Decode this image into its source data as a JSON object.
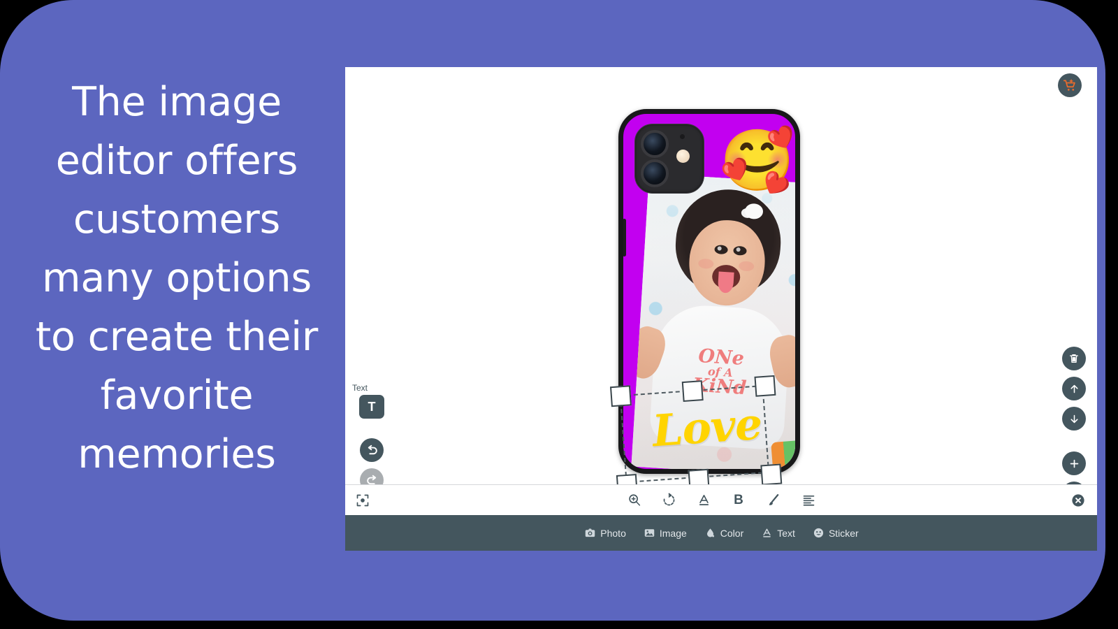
{
  "caption": {
    "text": "The image\neditor offers\ncustomers\nmany options\nto create their\nfavorite\nmemories"
  },
  "colors": {
    "backdrop": "#5c66bf",
    "toolbar": "#44565e",
    "case_background": "#c200f0",
    "love_text": "#ffd400",
    "cart_accent": "#ef6c2b",
    "shirt_text": "#ef7d7d"
  },
  "editor": {
    "cart_button": {
      "label": "",
      "icon": "add-to-cart-icon"
    },
    "left_tools": {
      "active_tool_label": "Text",
      "active_tool_glyph": "T",
      "undo_label": "Undo",
      "redo_label": "Redo",
      "redo_disabled": true
    },
    "right_tools": [
      {
        "name": "delete",
        "icon": "trash-icon",
        "label": "Delete"
      },
      {
        "name": "move-up",
        "icon": "arrow-up-icon",
        "label": "Bring forward"
      },
      {
        "name": "move-down",
        "icon": "arrow-down-icon",
        "label": "Send backward"
      },
      {
        "name": "zoom-in",
        "icon": "plus-icon",
        "label": "Zoom in"
      },
      {
        "name": "zoom-out",
        "icon": "minus-icon",
        "label": "Zoom out"
      }
    ],
    "text_toolbar": {
      "left_icon": "focus-center-icon",
      "items": [
        {
          "name": "size",
          "icon": "magnifier-plus-icon",
          "label": "Size"
        },
        {
          "name": "rotate",
          "icon": "rotate-icon",
          "label": "Rotate"
        },
        {
          "name": "underline",
          "icon": "underline-a-icon",
          "label": "A"
        },
        {
          "name": "bold",
          "icon": "bold-icon",
          "label": "B"
        },
        {
          "name": "brush",
          "icon": "brush-icon",
          "label": "Brush"
        },
        {
          "name": "align",
          "icon": "align-icon",
          "label": "Align"
        }
      ],
      "close_icon": "close-circle-icon"
    },
    "bottom_nav": [
      {
        "label": "Photo",
        "icon": "camera-icon"
      },
      {
        "label": "Image",
        "icon": "picture-icon"
      },
      {
        "label": "Color",
        "icon": "paint-drop-icon"
      },
      {
        "label": "Text",
        "icon": "text-a-icon"
      },
      {
        "label": "Sticker",
        "icon": "smiley-icon"
      }
    ]
  },
  "design": {
    "product": "phone-case",
    "case_color": "#c200f0",
    "sticker_emoji": "🥰",
    "selected_layer": {
      "type": "text",
      "value": "Love",
      "color": "#ffd400",
      "rotation_deg": -4,
      "selected": true
    },
    "photo": {
      "subject": "baby",
      "shirt_text_line1": "ONe",
      "shirt_text_line2": "of A",
      "shirt_text_line3": "KiNd",
      "rotation_deg": 3.5
    }
  }
}
